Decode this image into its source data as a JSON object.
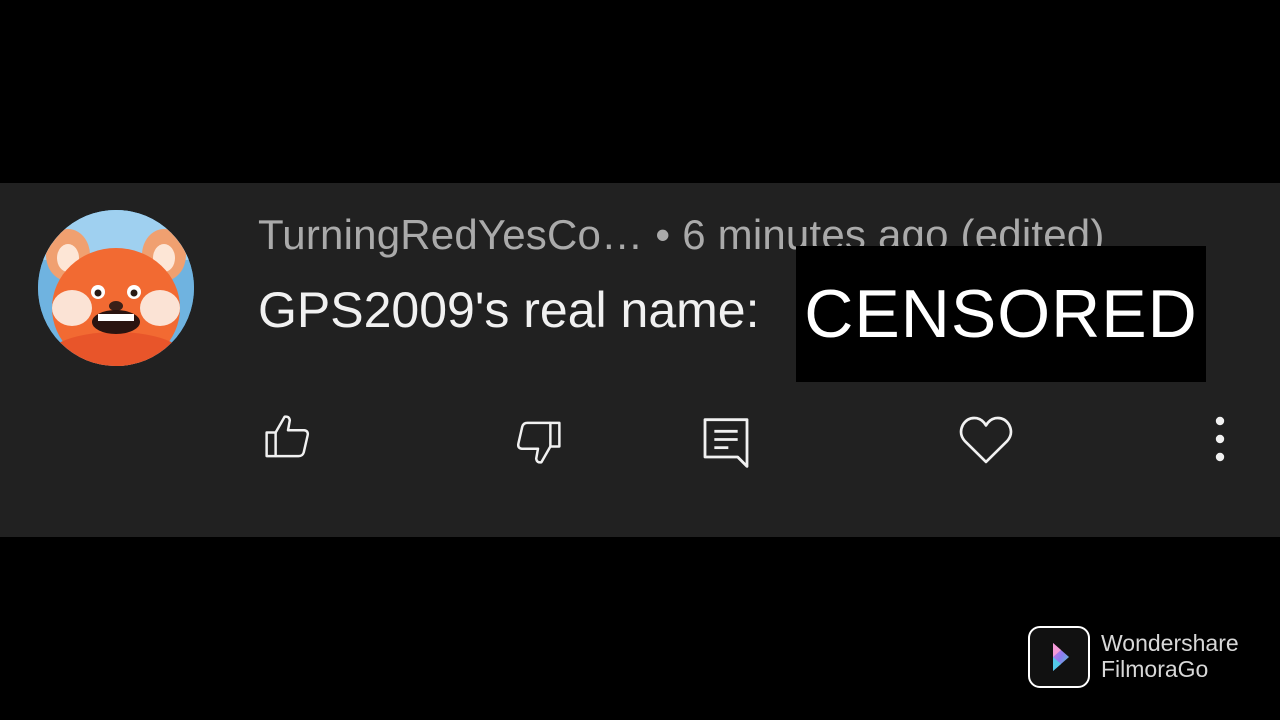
{
  "comment": {
    "author": "TurningRedYesCo…",
    "separator": "•",
    "timestamp": "6 minutes ago (edited)",
    "text": "GPS2009's real name:",
    "censor_label": "CENSORED"
  },
  "actions": {
    "like_icon": "thumbs-up-icon",
    "dislike_icon": "thumbs-down-icon",
    "reply_icon": "comment-reply-icon",
    "heart_icon": "heart-icon",
    "more_icon": "more-vertical-icon"
  },
  "watermark": {
    "line1": "Wondershare",
    "line2": "FilmoraGo"
  },
  "colors": {
    "background": "#000000",
    "card": "#212121",
    "meta_text": "#aaaaaa",
    "body_text": "#f1f1f1",
    "icon": "#f1f1f1"
  }
}
